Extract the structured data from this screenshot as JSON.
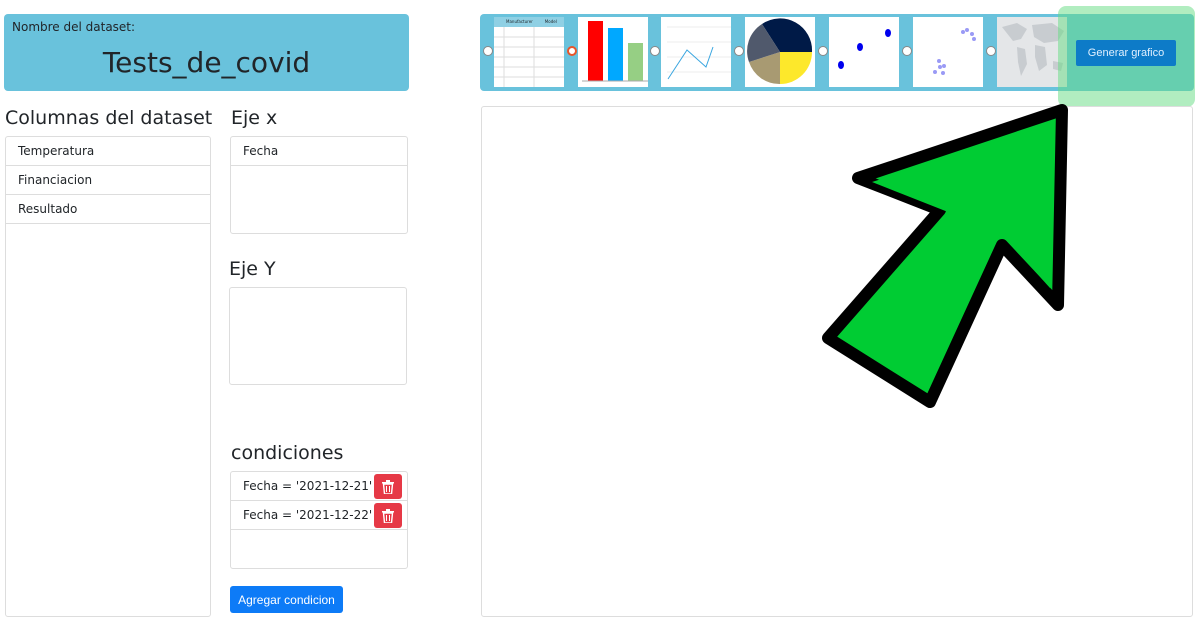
{
  "dataset": {
    "label": "Nombre del dataset:",
    "name": "Tests_de_covid"
  },
  "columns": {
    "title": "Columnas del dataset",
    "items": [
      "Temperatura",
      "Financiacion",
      "Resultado"
    ]
  },
  "x_axis": {
    "title": "Eje x",
    "items": [
      "Fecha"
    ]
  },
  "y_axis": {
    "title": "Eje Y",
    "items": []
  },
  "conditions": {
    "title": "condiciones",
    "items": [
      "Fecha = '2021-12-21'",
      "Fecha = '2021-12-22'"
    ],
    "add_label": "Agregar condicion"
  },
  "chart_types": {
    "options": [
      "table",
      "bar",
      "line",
      "pie",
      "scatter",
      "bubble",
      "map"
    ],
    "selected": "bar",
    "table_thumb": {
      "headers": [
        "Manufacturer",
        "Model"
      ]
    },
    "bar_thumb": {
      "labels": [
        "Red",
        "Blue",
        "Green"
      ]
    }
  },
  "generate_label": "Generar grafico",
  "colors": {
    "panel": "#69c2dc",
    "primary": "#0d7bf7",
    "danger": "#e63946",
    "arrow": "#00cc33",
    "highlight": "#64dc82"
  }
}
